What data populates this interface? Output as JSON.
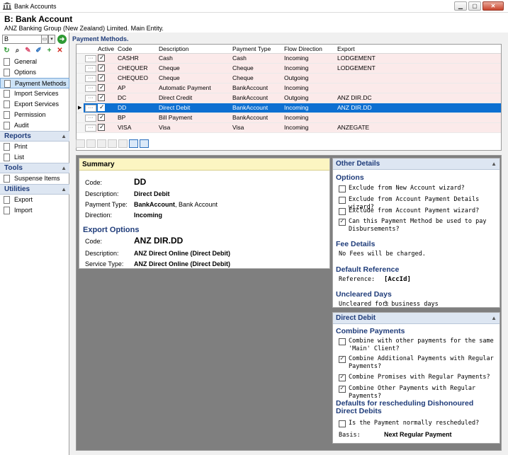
{
  "window": {
    "title": "Bank Accounts",
    "min": "▁",
    "max": "▢",
    "close": "✕"
  },
  "header": {
    "title": "B: Bank Account",
    "subtitle": "ANZ Banking Group (New Zealand) Limited. Main Entity."
  },
  "picker": {
    "value": "B"
  },
  "nav": {
    "items": [
      "General",
      "Options",
      "Payment Methods",
      "Import Services",
      "Export Services",
      "Permission",
      "Audit"
    ],
    "selected": "Payment Methods",
    "reports": {
      "label": "Reports",
      "items": [
        "Print",
        "List"
      ]
    },
    "tools": {
      "label": "Tools",
      "items": [
        "Suspense Items"
      ]
    },
    "utilities": {
      "label": "Utilities",
      "items": [
        "Export",
        "Import"
      ]
    }
  },
  "payment_methods": {
    "label": "Payment Methods.",
    "columns": [
      "Active",
      "Code",
      "Description",
      "Payment Type",
      "Flow Direction",
      "Export"
    ],
    "rows": [
      {
        "active": true,
        "code": "CASHR",
        "description": "Cash",
        "type": "Cash",
        "flow": "Incoming",
        "export": "LODGEMENT"
      },
      {
        "active": true,
        "code": "CHEQUER",
        "description": "Cheque",
        "type": "Cheque",
        "flow": "Incoming",
        "export": "LODGEMENT"
      },
      {
        "active": true,
        "code": "CHEQUEO",
        "description": "Cheque",
        "type": "Cheque",
        "flow": "Outgoing",
        "export": ""
      },
      {
        "active": true,
        "code": "AP",
        "description": "Automatic Payment",
        "type": "BankAccount",
        "flow": "Incoming",
        "export": ""
      },
      {
        "active": true,
        "code": "DC",
        "description": "Direct Credit",
        "type": "BankAccount",
        "flow": "Outgoing",
        "export": "ANZ DIR.DC"
      },
      {
        "active": true,
        "code": "DD",
        "description": "Direct Debit",
        "type": "BankAccount",
        "flow": "Incoming",
        "export": "ANZ DIR.DD",
        "selected": true
      },
      {
        "active": true,
        "code": "BP",
        "description": "Bill Payment",
        "type": "BankAccount",
        "flow": "Incoming",
        "export": ""
      },
      {
        "active": true,
        "code": "VISA",
        "description": "Visa",
        "type": "Visa",
        "flow": "Incoming",
        "export": "ANZEGATE"
      }
    ]
  },
  "summary": {
    "heading": "Summary",
    "code_label": "Code:",
    "code": "DD",
    "description_label": "Description:",
    "description": "Direct Debit",
    "payment_type_label": "Payment Type:",
    "payment_type_bold": "BankAccount",
    "payment_type_rest": ", Bank Account",
    "direction_label": "Direction:",
    "direction": "Incoming",
    "export_heading": "Export Options",
    "export_code_label": "Code:",
    "export_code": "ANZ DIR.DD",
    "export_description_label": "Description:",
    "export_description": "ANZ Direct Online (Direct Debit)",
    "service_type_label": "Service Type:",
    "service_type": "ANZ Direct Online (Direct Debit)"
  },
  "other_details": {
    "heading": "Other Details",
    "options_heading": "Options",
    "options": [
      {
        "label": "Exclude from New Account wizard?",
        "checked": false
      },
      {
        "label": "Exclude from Account Payment Details wizard?",
        "checked": false
      },
      {
        "label": "Exclude from Account Payment wizard?",
        "checked": false
      },
      {
        "label": "Can this Payment Method be used to pay Disbursements?",
        "checked": true
      }
    ],
    "fee_heading": "Fee Details",
    "fee_text": "No Fees will be charged.",
    "ref_heading": "Default Reference",
    "ref_label": "Reference:",
    "ref_value": "[AccId]",
    "uncleared_heading": "Uncleared Days",
    "uncleared_label": "Uncleared for:",
    "uncleared_value": "3 business days"
  },
  "direct_debit": {
    "heading": "Direct Debit",
    "combine_heading": "Combine Payments",
    "combine": [
      {
        "label": "Combine with other payments for the same 'Main' Client?",
        "checked": false
      },
      {
        "label": "Combine Additional Payments with Regular Payments?",
        "checked": true
      },
      {
        "label": "Combine Promises with Regular Payments?",
        "checked": true
      },
      {
        "label": "Combine Other Payments with Regular Payments?",
        "checked": true
      }
    ],
    "resched_heading": "Defaults for rescheduling Dishonoured Direct Debits",
    "resched_question": "Is the Payment normally rescheduled?",
    "resched_checked": false,
    "basis_label": "Basis:",
    "basis_value": "Next Regular Payment"
  },
  "colors": {
    "accent": "#1f3c7a",
    "selection": "#0d6fd1",
    "row_tint": "#fbeaea",
    "summary_head": "#fcf5c2",
    "panel_head": "#dde6f2"
  }
}
